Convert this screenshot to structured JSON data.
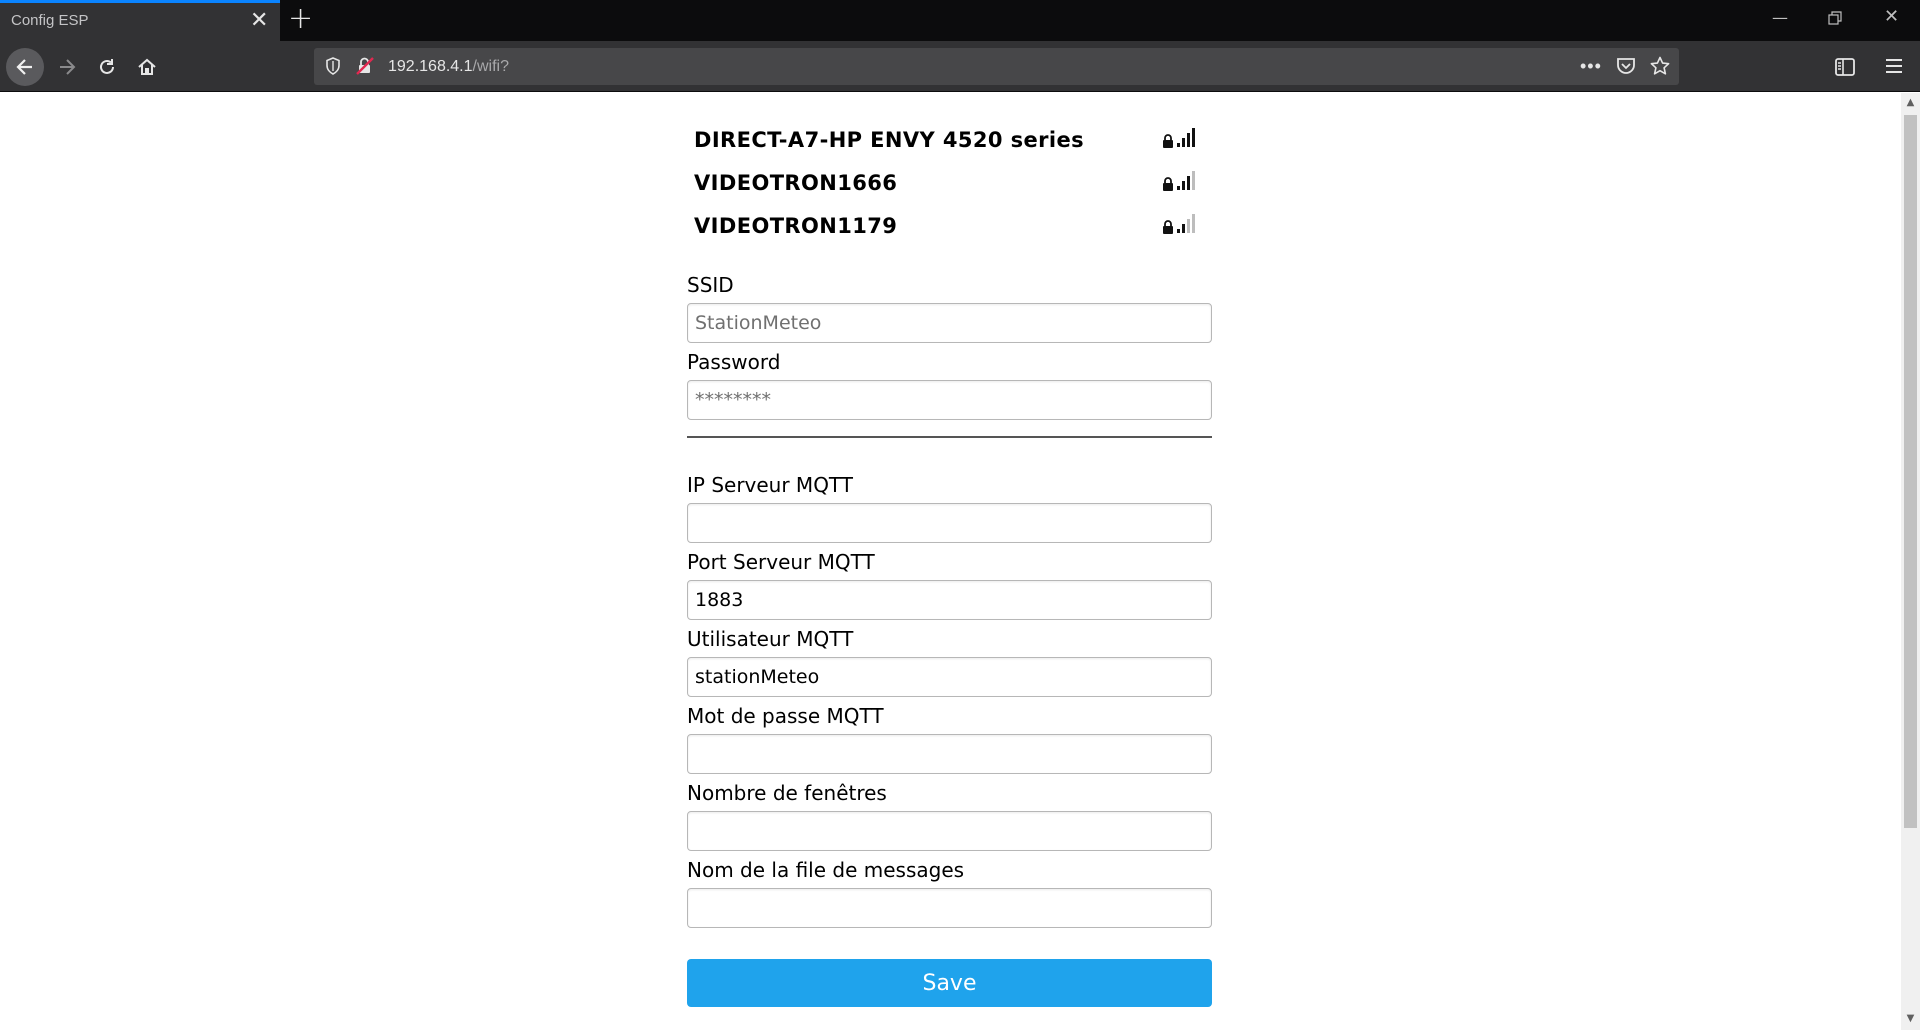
{
  "browser": {
    "tab_title": "Config ESP",
    "url_host": "192.168.4.1",
    "url_path": "/wifi?"
  },
  "networks": [
    {
      "ssid": "DIRECT-A7-HP ENVY 4520 series",
      "signal": 4
    },
    {
      "ssid": "VIDEOTRON1666",
      "signal": 3
    },
    {
      "ssid": "VIDEOTRON1179",
      "signal": 2
    }
  ],
  "form": {
    "ssid_label": "SSID",
    "ssid_placeholder": "StationMeteo",
    "password_label": "Password",
    "password_placeholder": "********",
    "mqtt_ip_label": "IP Serveur MQTT",
    "mqtt_port_label": "Port Serveur MQTT",
    "mqtt_port_value": "1883",
    "mqtt_user_label": "Utilisateur MQTT",
    "mqtt_user_value": "stationMeteo",
    "mqtt_pass_label": "Mot de passe MQTT",
    "window_count_label": "Nombre de fenêtres",
    "queue_name_label": "Nom de la file de messages",
    "save_label": "Save"
  },
  "colors": {
    "save_button": "#1fa3ec",
    "tab_accent": "#0a84ff"
  }
}
